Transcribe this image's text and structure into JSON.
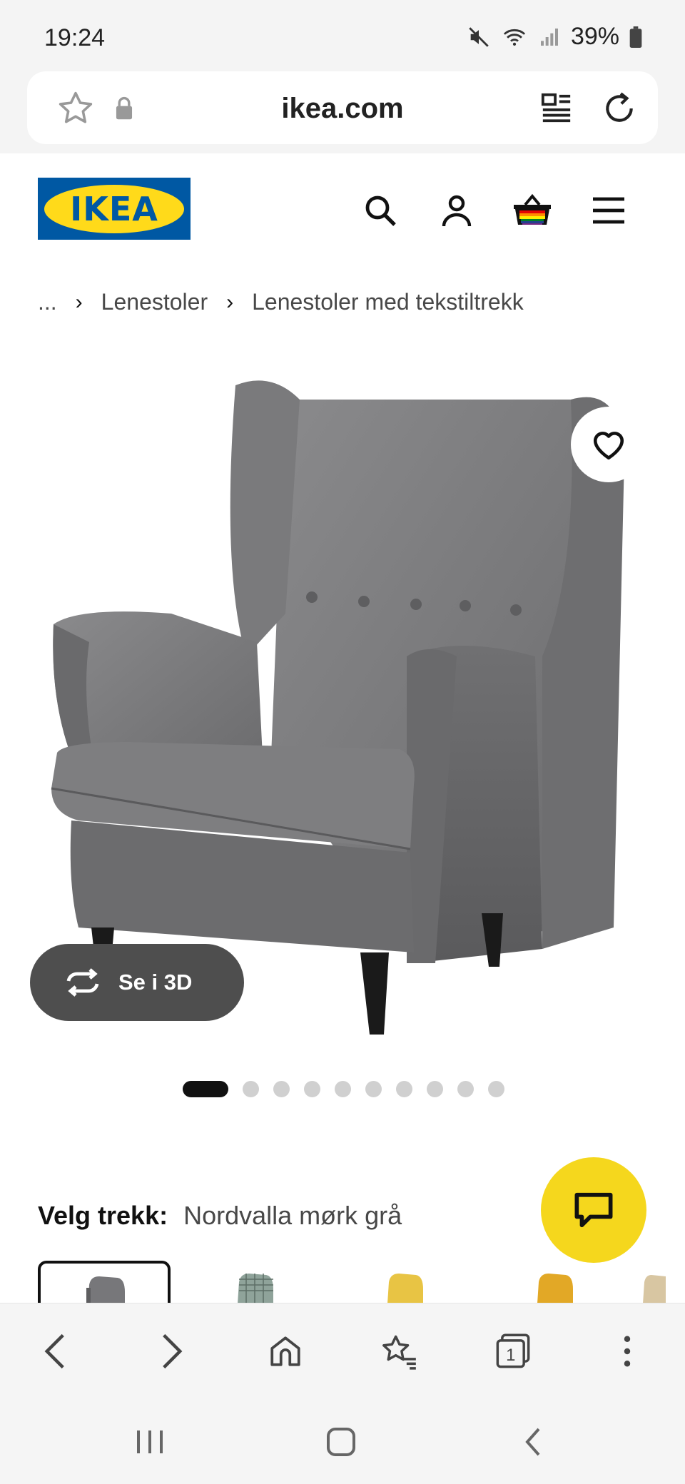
{
  "status": {
    "time": "19:24",
    "battery": "39%"
  },
  "browser": {
    "url": "ikea.com"
  },
  "site": {
    "logo": "IKEA"
  },
  "breadcrumb": {
    "ellipsis": "...",
    "items": [
      "Lenestoler",
      "Lenestoler med tekstiltrekk"
    ]
  },
  "product": {
    "view3d_label": "Se i 3D",
    "image_count": 10,
    "active_image": 1
  },
  "cover": {
    "label": "Velg trekk:",
    "value": "Nordvalla mørk grå"
  },
  "colors": {
    "ikea_blue": "#0058a3",
    "ikea_yellow": "#ffda1a",
    "chat_yellow": "#f5d71d"
  },
  "icons": {
    "status": [
      "mute-icon",
      "wifi-icon",
      "signal-icon",
      "battery-icon"
    ],
    "urlbar": [
      "star-icon",
      "lock-icon",
      "reader-icon",
      "reload-icon"
    ],
    "header": [
      "search-icon",
      "account-icon",
      "basket-icon",
      "menu-icon"
    ],
    "toolbar": [
      "back-icon",
      "forward-icon",
      "home-icon",
      "bookmarks-icon",
      "tabs-icon",
      "more-icon"
    ],
    "system": [
      "recents-icon",
      "home-icon",
      "back-icon"
    ]
  }
}
